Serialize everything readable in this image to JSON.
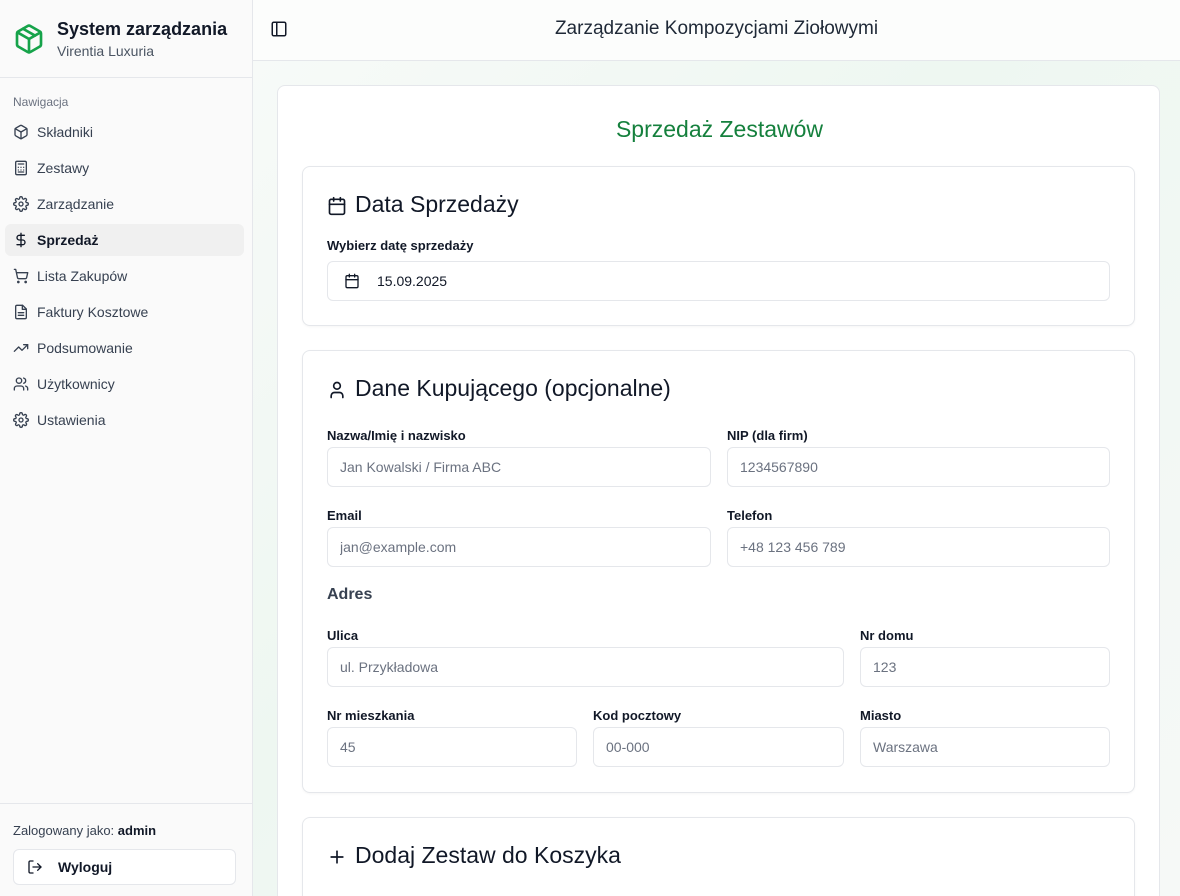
{
  "sidebar": {
    "title": "System zarządzania",
    "subtitle": "Virentia Luxuria",
    "nav_caption": "Nawigacja",
    "items": [
      {
        "label": "Składniki",
        "icon": "package-icon"
      },
      {
        "label": "Zestawy",
        "icon": "calculator-icon"
      },
      {
        "label": "Zarządzanie",
        "icon": "gear-icon"
      },
      {
        "label": "Sprzedaż",
        "icon": "dollar-icon"
      },
      {
        "label": "Lista Zakupów",
        "icon": "cart-icon"
      },
      {
        "label": "Faktury Kosztowe",
        "icon": "file-icon"
      },
      {
        "label": "Podsumowanie",
        "icon": "trending-up-icon"
      },
      {
        "label": "Użytkownicy",
        "icon": "users-icon"
      },
      {
        "label": "Ustawienia",
        "icon": "settings-icon"
      }
    ],
    "active_item": "Sprzedaż",
    "logged_prefix": "Zalogowany jako:",
    "logged_user": "admin",
    "logout_label": "Wyloguj"
  },
  "header": {
    "title": "Zarządzanie Kompozycjami Ziołowymi"
  },
  "main": {
    "title": "Sprzedaż Zestawów",
    "date_card": {
      "title": "Data Sprzedaży",
      "label": "Wybierz datę sprzedaży",
      "value": "15.09.2025"
    },
    "buyer_card": {
      "title": "Dane Kupującego (opcjonalne)",
      "name_label": "Nazwa/Imię i nazwisko",
      "name_placeholder": "Jan Kowalski / Firma ABC",
      "nip_label": "NIP (dla firm)",
      "nip_placeholder": "1234567890",
      "email_label": "Email",
      "email_placeholder": "jan@example.com",
      "phone_label": "Telefon",
      "phone_placeholder": "+48 123 456 789",
      "address_heading": "Adres",
      "street_label": "Ulica",
      "street_placeholder": "ul. Przykładowa",
      "house_label": "Nr domu",
      "house_placeholder": "123",
      "apt_label": "Nr mieszkania",
      "apt_placeholder": "45",
      "postal_label": "Kod pocztowy",
      "postal_placeholder": "00-000",
      "city_label": "Miasto",
      "city_placeholder": "Warszawa"
    },
    "cart_card": {
      "title": "Dodaj Zestaw do Koszyka"
    }
  },
  "colors": {
    "accent": "#15803d",
    "brand_icon": "#16a34a"
  }
}
